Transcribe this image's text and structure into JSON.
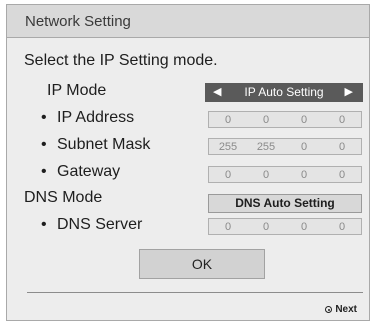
{
  "dialog": {
    "title": "Network Setting",
    "prompt": "Select the IP Setting mode."
  },
  "ip_mode": {
    "label": "IP Mode",
    "value": "IP Auto Setting",
    "left_arrow": "◀",
    "right_arrow": "▶"
  },
  "bullet": "•",
  "ip_address": {
    "label": "IP Address",
    "octets": [
      "0",
      "0",
      "0",
      "0"
    ]
  },
  "subnet_mask": {
    "label": "Subnet Mask",
    "octets": [
      "255",
      "255",
      "0",
      "0"
    ]
  },
  "gateway": {
    "label": "Gateway",
    "octets": [
      "0",
      "0",
      "0",
      "0"
    ]
  },
  "dns_mode": {
    "label": "DNS Mode",
    "value": "DNS Auto Setting"
  },
  "dns_server": {
    "label": "DNS Server",
    "octets": [
      "0",
      "0",
      "0",
      "0"
    ]
  },
  "ok_label": "OK",
  "footer": {
    "next_label": "Next",
    "next_icon": "ok-button-icon"
  },
  "colors": {
    "dialog_bg": "#ededed",
    "titlebar_bg": "#d9d9d9",
    "selector_bg": "#5a5a5a",
    "field_text": "#8a8a8a"
  }
}
